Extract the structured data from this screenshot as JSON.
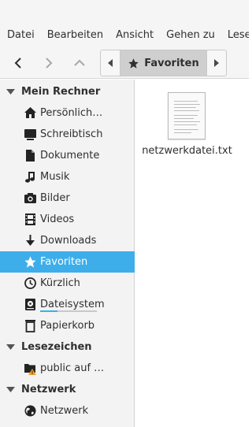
{
  "menubar": {
    "items": [
      "Datei",
      "Bearbeiten",
      "Ansicht",
      "Gehen zu",
      "Lesezeic"
    ]
  },
  "toolbar": {
    "back_icon": "chevron-left-icon",
    "forward_icon": "chevron-right-icon",
    "up_icon": "chevron-up-icon"
  },
  "pathbar": {
    "current": "Favoriten",
    "icon": "star-icon"
  },
  "sidebar": {
    "sections": [
      {
        "title": "Mein Rechner"
      },
      {
        "title": "Lesezeichen"
      },
      {
        "title": "Netzwerk"
      }
    ],
    "items": [
      {
        "label": "Persönlich…",
        "icon": "home-icon"
      },
      {
        "label": "Schreibtisch",
        "icon": "desktop-icon"
      },
      {
        "label": "Dokumente",
        "icon": "document-icon"
      },
      {
        "label": "Musik",
        "icon": "music-icon"
      },
      {
        "label": "Bilder",
        "icon": "camera-icon"
      },
      {
        "label": "Videos",
        "icon": "film-icon"
      },
      {
        "label": "Downloads",
        "icon": "download-icon"
      },
      {
        "label": "Favoriten",
        "icon": "star-icon",
        "selected": true
      },
      {
        "label": "Kürzlich",
        "icon": "clock-icon"
      },
      {
        "label": "Dateisystem",
        "icon": "drive-icon",
        "usage": 0.3
      },
      {
        "label": "Papierkorb",
        "icon": "trash-icon"
      },
      {
        "label": "public auf …",
        "icon": "network-folder-icon"
      },
      {
        "label": "Netzwerk",
        "icon": "globe-icon"
      }
    ]
  },
  "files": [
    {
      "name": "netzwerkdatei.txt",
      "icon": "text-file-icon"
    }
  ],
  "colors": {
    "accent": "#3daee9",
    "warning": "#f0a030"
  }
}
